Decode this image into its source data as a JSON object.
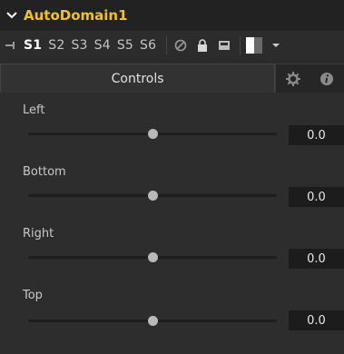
{
  "tool": {
    "name": "AutoDomain1"
  },
  "toolbar": {
    "slots": [
      "S1",
      "S2",
      "S3",
      "S4",
      "S5",
      "S6"
    ],
    "active_slot": "S1",
    "icons": [
      "pin-icon",
      "disable-icon",
      "lock-icon",
      "save-icon",
      "color-swatch-icon",
      "dropdown-arrow-icon"
    ]
  },
  "tabs": {
    "controls_label": "Controls",
    "icons": [
      "gear-icon",
      "info-icon"
    ]
  },
  "controls": [
    {
      "label": "Left",
      "value": "0.0",
      "level": 0.5
    },
    {
      "label": "Bottom",
      "value": "0.0",
      "level": 0.5
    },
    {
      "label": "Right",
      "value": "0.0",
      "level": 0.5
    },
    {
      "label": "Top",
      "value": "0.0",
      "level": 0.5
    }
  ],
  "colors": {
    "title_accent": "#f2c11a",
    "background": "#2d2d2d",
    "value_box": "#1c1c1c"
  }
}
